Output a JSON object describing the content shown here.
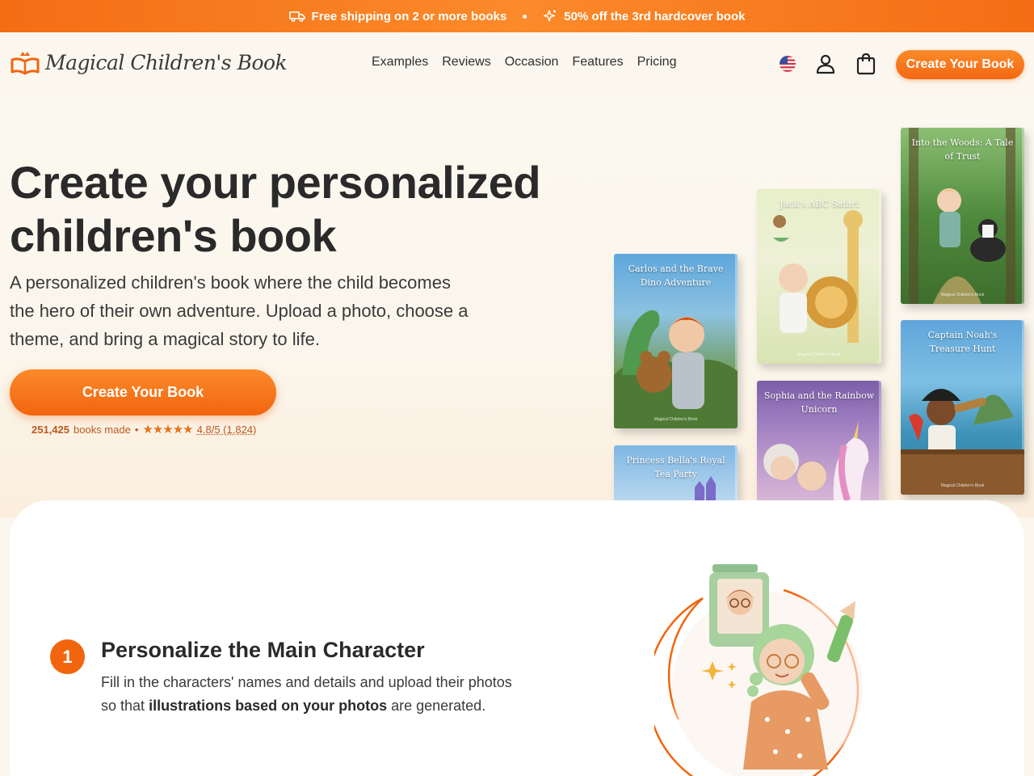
{
  "promo": {
    "shipping": "Free shipping on 2 or more books",
    "discount": "50% off the 3rd hardcover book"
  },
  "brand": {
    "name": "Magical Children's Book"
  },
  "nav": {
    "items": [
      "Examples",
      "Reviews",
      "Occasion",
      "Features",
      "Pricing"
    ]
  },
  "header": {
    "cta": "Create Your Book"
  },
  "hero": {
    "title": "Create your personalized children's book",
    "subtitle": "A personalized children's book where the child becomes the hero of their own adventure. Upload a photo, choose a theme, and bring a magical story to life.",
    "cta": "Create Your Book",
    "books_count": "251,425",
    "books_label": "books made",
    "separator": "•",
    "stars": "★★★★★",
    "rating": "4.8/5 (1,824)"
  },
  "books": [
    {
      "title": "Carlos and the Brave Dino Adventure",
      "label": "Magical Children's Book"
    },
    {
      "title": "Jack's ABC Safari",
      "label": "Magical Children's Book"
    },
    {
      "title": "Into the Woods: A Tale of Trust",
      "label": "Magical Children's Book"
    },
    {
      "title": "Princess Bella's Royal Tea Party",
      "label": "Magical Children's Book"
    },
    {
      "title": "Sophia and the Rainbow Unicorn",
      "label": "Magical Children's Book"
    },
    {
      "title": "Captain Noah's Treasure Hunt",
      "label": "Magical Children's Book"
    }
  ],
  "step": {
    "number": "1",
    "title": "Personalize the Main Character",
    "desc_before": "Fill in the characters' names and details and upload their photos so that",
    "desc_bold": "illustrations based on your photos",
    "desc_after": "are generated."
  },
  "colors": {
    "accent": "#f46d14",
    "background": "#fbf7ef",
    "card": "#ffffff"
  }
}
